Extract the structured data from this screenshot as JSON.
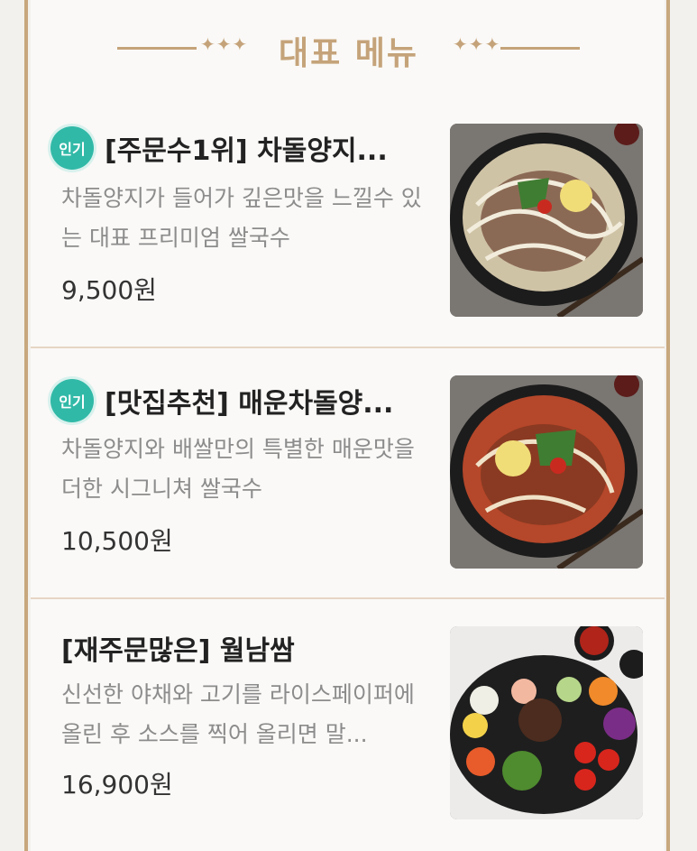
{
  "header": {
    "title": "대표 메뉴",
    "deco_left": "✦✦✦",
    "deco_right": "✦✦✦"
  },
  "menu": {
    "items": [
      {
        "badge": "인기",
        "name": "[주문수1위] 차돌양지...",
        "description": "차돌양지가 들어가 깊은맛을 느낄수 있는 대표 프리미엄 쌀국수",
        "price": "9,500원",
        "image": "pho-brisket-photo"
      },
      {
        "badge": "인기",
        "name": "[맛집추천] 매운차돌양...",
        "description": "차돌양지와 배쌀만의 특별한 매운맛을 더한 시그니쳐 쌀국수",
        "price": "10,500원",
        "image": "spicy-pho-photo"
      },
      {
        "badge": "",
        "name": "[재주문많은] 월남쌈",
        "description": "신선한 야채와 고기를 라이스페이퍼에 올린 후 소스를 찍어 올리면 말...",
        "price": "16,900원",
        "image": "spring-roll-platter-photo"
      }
    ]
  },
  "colors": {
    "accent_gold": "#c5a37a",
    "badge_teal": "#31b9a7"
  }
}
